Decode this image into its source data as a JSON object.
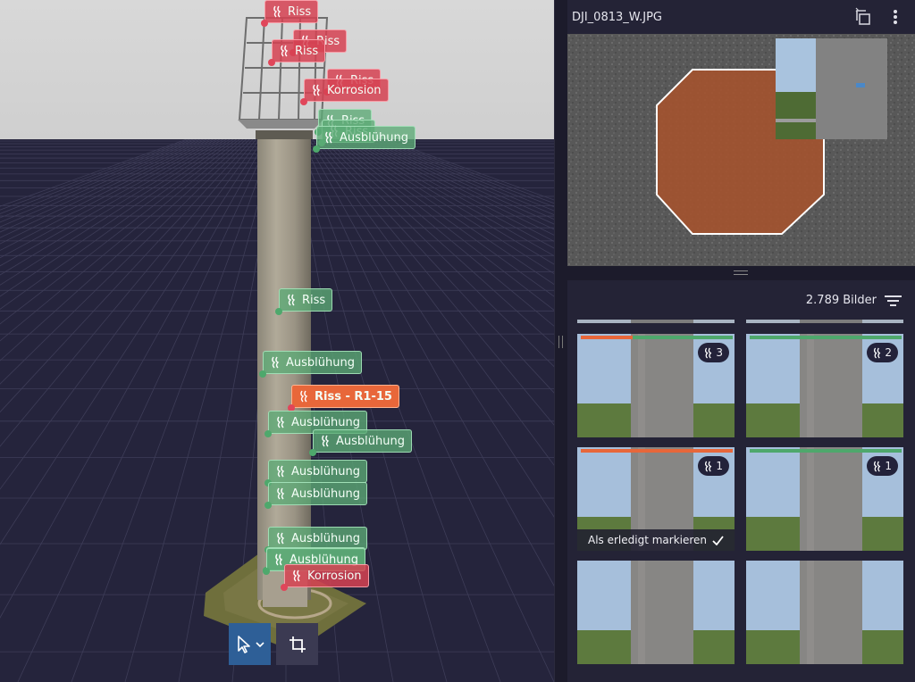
{
  "viewport": {
    "tags": [
      {
        "label": "Riss",
        "color": "red"
      },
      {
        "label": "Riss",
        "color": "red"
      },
      {
        "label": "Riss",
        "color": "red"
      },
      {
        "label": "Riss",
        "color": "red"
      },
      {
        "label": "Korrosion",
        "color": "red"
      },
      {
        "label": "Riss",
        "color": "green"
      },
      {
        "label": "Riss",
        "color": "green"
      },
      {
        "label": "Ausblühung",
        "color": "green"
      },
      {
        "label": "Riss",
        "color": "green"
      },
      {
        "label": "Ausblühung",
        "color": "green"
      },
      {
        "label": "Riss - R1-15",
        "color": "orange"
      },
      {
        "label": "Ausblühung",
        "color": "green"
      },
      {
        "label": "Ausblühung",
        "color": "green"
      },
      {
        "label": "Ausblühung",
        "color": "green"
      },
      {
        "label": "Ausblühung",
        "color": "green"
      },
      {
        "label": "Ausblühung",
        "color": "green"
      },
      {
        "label": "Ausblühung",
        "color": "green"
      },
      {
        "label": "Ausblühung",
        "color": "green"
      },
      {
        "label": "Korrosion",
        "color": "red"
      }
    ],
    "tools": {
      "select": "select-arrow-icon",
      "crop": "crop-icon"
    }
  },
  "panel": {
    "file_name": "DJI_0813_W.JPG",
    "gallery": {
      "count_label": "2.789 Bilder",
      "thumbnails": [
        {
          "badge": "3",
          "bar_colors": [
            "#e8673a",
            "#4ea86c"
          ]
        },
        {
          "badge": "2",
          "bar_colors": [
            "#4ea86c"
          ]
        },
        {
          "badge": "1",
          "bar_colors": [
            "#e8673a"
          ],
          "action": "Als erledigt markieren"
        },
        {
          "badge": "1",
          "bar_colors": [
            "#4ea86c"
          ]
        },
        {},
        {}
      ]
    }
  },
  "colors": {
    "accent_blue": "#2e5f97",
    "defect_orange": "#e8673a",
    "defect_green": "#4ea86c",
    "defect_red": "#d64252"
  }
}
